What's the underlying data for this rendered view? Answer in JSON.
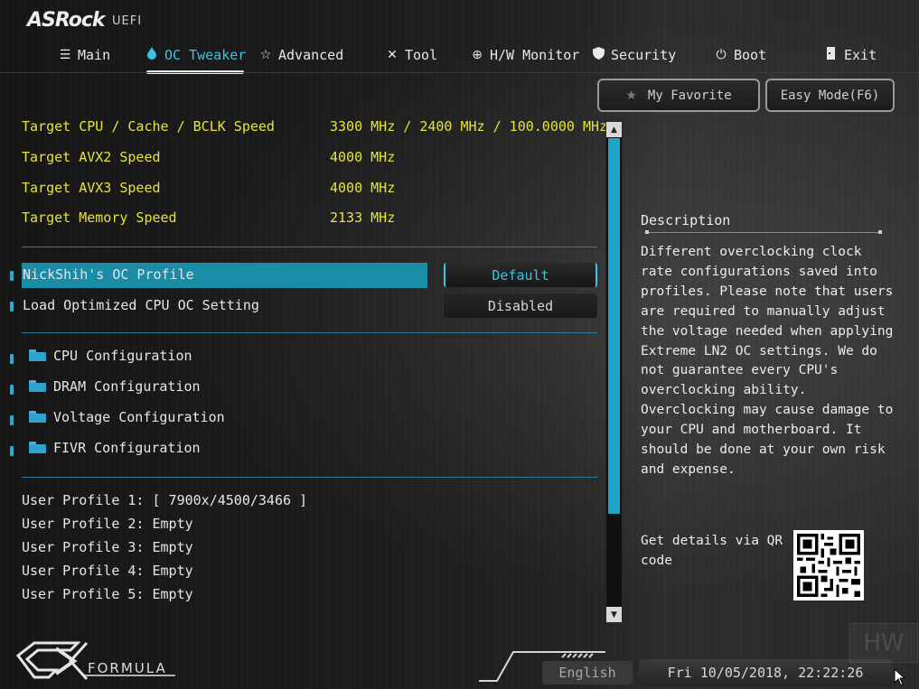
{
  "brand": {
    "logo": "ASRock",
    "suffix": "UEFI"
  },
  "nav": {
    "items": [
      {
        "label": "Main",
        "icon": "list-icon"
      },
      {
        "label": "OC Tweaker",
        "icon": "flame-icon",
        "active": true
      },
      {
        "label": "Advanced",
        "icon": "star-icon"
      },
      {
        "label": "Tool",
        "icon": "tools-icon"
      },
      {
        "label": "H/W Monitor",
        "icon": "monitor-icon"
      },
      {
        "label": "Security",
        "icon": "shield-icon"
      },
      {
        "label": "Boot",
        "icon": "power-icon"
      },
      {
        "label": "Exit",
        "icon": "exit-icon"
      }
    ]
  },
  "top_buttons": {
    "favorite": "My Favorite",
    "easy_mode": "Easy Mode(F6)"
  },
  "targets": [
    {
      "label": "Target CPU / Cache / BCLK Speed",
      "value": "3300 MHz / 2400 MHz / 100.0000 MHz"
    },
    {
      "label": "Target AVX2 Speed",
      "value": "4000 MHz"
    },
    {
      "label": "Target AVX3 Speed",
      "value": "4000 MHz"
    },
    {
      "label": "Target Memory Speed",
      "value": "2133 MHz"
    }
  ],
  "settings": [
    {
      "label": "NickShih's OC Profile",
      "value": "Default",
      "selected": true
    },
    {
      "label": "Load Optimized CPU OC Setting",
      "value": "Disabled"
    }
  ],
  "submenus": [
    "CPU Configuration",
    "DRAM Configuration",
    "Voltage Configuration",
    "FIVR Configuration"
  ],
  "profiles": [
    "User Profile 1: [ 7900x/4500/3466 ]",
    "User Profile 2: Empty",
    "User Profile 3: Empty",
    "User Profile 4: Empty",
    "User Profile 5: Empty"
  ],
  "description": {
    "title": "Description",
    "text": "Different overclocking clock rate configurations saved into profiles. Please note that users are required to manually adjust the voltage needed when applying Extreme LN2 OC settings. We do not guarantee every CPU's overclocking ability. Overclocking may cause damage to your CPU and motherboard. It should be done at your own risk and expense.",
    "qr_text": "Get details via QR code"
  },
  "footer": {
    "logo_text": "FORMULA",
    "language": "English",
    "datetime": "Fri 10/05/2018, 22:22:26",
    "watermark": "HW"
  },
  "colors": {
    "accent": "#1da6c8",
    "highlight": "#1a8ca5",
    "target_text": "#e8e33a",
    "separator": "#2a7d8e"
  }
}
